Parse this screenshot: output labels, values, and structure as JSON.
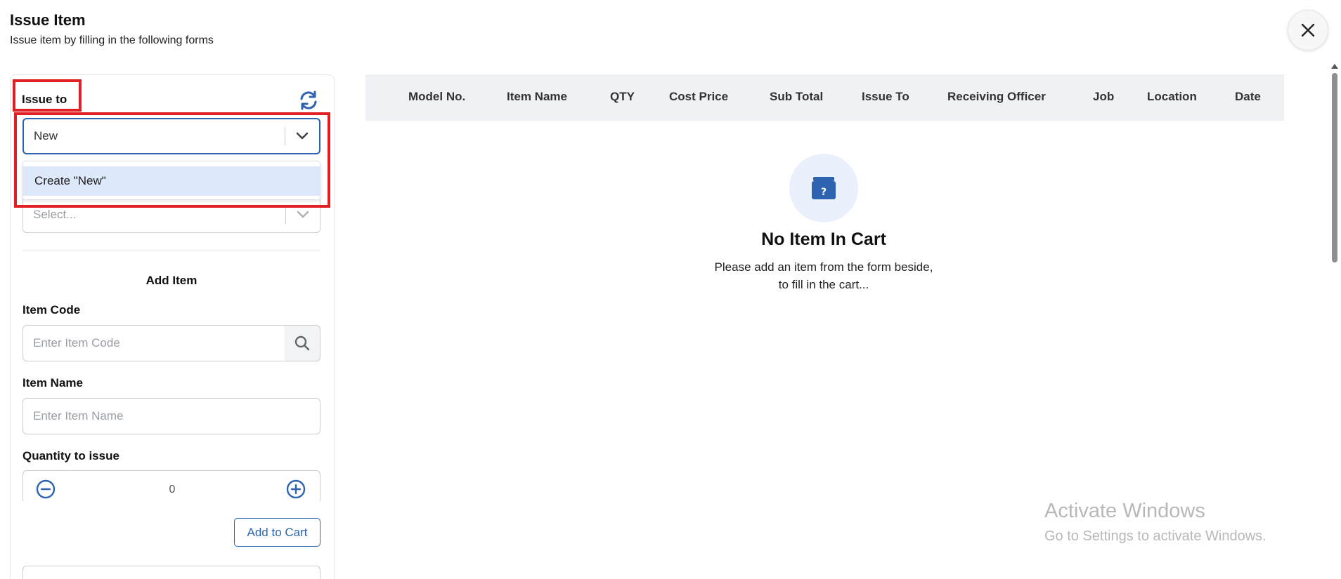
{
  "header": {
    "title": "Issue Item",
    "subtitle": "Issue item by filling in the following forms"
  },
  "form": {
    "issue_to_label": "Issue to",
    "issue_to_value": "New",
    "issue_to_menu_option": "Create \"New\"",
    "second_select_placeholder": "Select...",
    "add_item_title": "Add Item",
    "item_code_label": "Item Code",
    "item_code_placeholder": "Enter Item Code",
    "item_name_label": "Item Name",
    "item_name_placeholder": "Enter Item Name",
    "quantity_label": "Quantity to issue",
    "quantity_value": "0",
    "add_to_cart_label": "Add to Cart"
  },
  "cart": {
    "columns": [
      "Model No.",
      "Item Name",
      "QTY",
      "Cost Price",
      "Sub Total",
      "Issue To",
      "Receiving Officer",
      "Job",
      "Location",
      "Date"
    ],
    "empty_title": "No Item In Cart",
    "empty_text_line1": "Please add an item from the form beside,",
    "empty_text_line2": "to fill in the cart..."
  },
  "watermark": {
    "title": "Activate Windows",
    "subtitle": "Go to Settings to activate Windows."
  },
  "icons": {
    "close": "close-icon",
    "refresh": "refresh-icon",
    "dropdown": "chevron-down-icon",
    "search": "search-icon",
    "decrement": "minus-circle-icon",
    "increment": "plus-circle-icon",
    "empty_cart": "archive-box-question-icon"
  },
  "colors": {
    "accent": "#2d63b0",
    "highlight": "#e01e24",
    "menu_option_bg": "#dde8fb"
  }
}
